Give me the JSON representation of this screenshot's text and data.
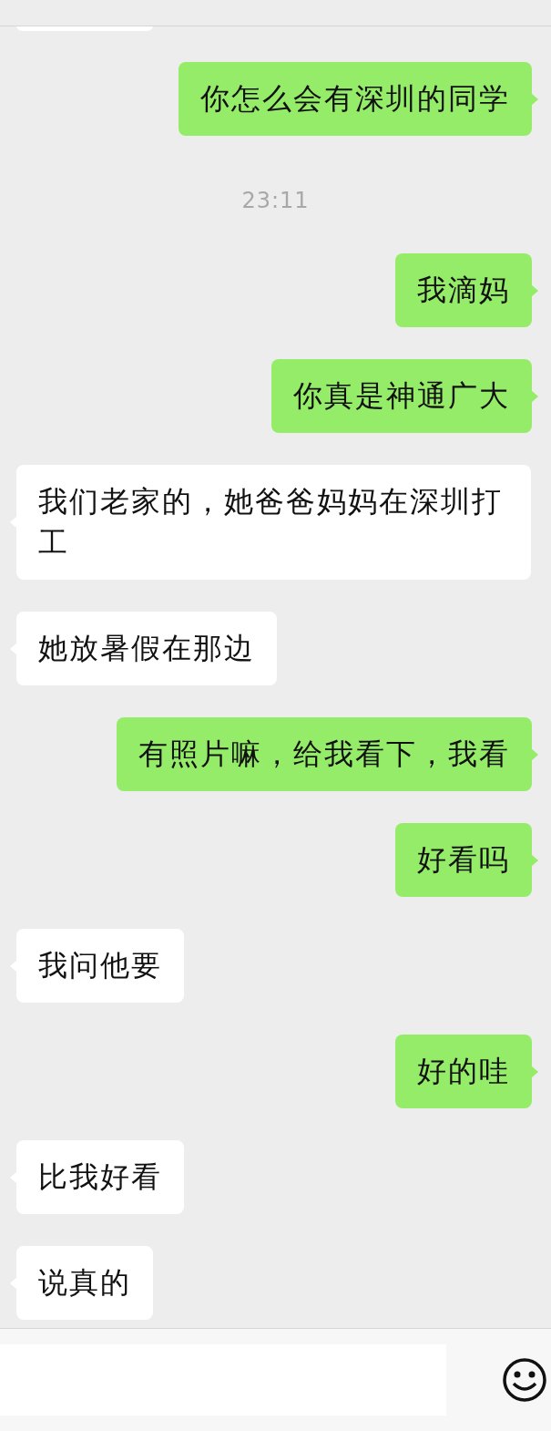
{
  "messages": [
    {
      "kind": "sent",
      "text": "你怎么会有深圳的同学"
    },
    {
      "kind": "time",
      "text": "23:11"
    },
    {
      "kind": "sent",
      "text": "我滴妈"
    },
    {
      "kind": "sent",
      "text": "你真是神通广大"
    },
    {
      "kind": "received",
      "text": "我们老家的，她爸爸妈妈在深圳打工"
    },
    {
      "kind": "received",
      "text": "她放暑假在那边"
    },
    {
      "kind": "sent",
      "text": "有照片嘛，给我看下，我看"
    },
    {
      "kind": "sent",
      "text": "好看吗"
    },
    {
      "kind": "received",
      "text": "我问他要"
    },
    {
      "kind": "sent",
      "text": "好的哇"
    },
    {
      "kind": "received",
      "text": "比我好看"
    },
    {
      "kind": "received",
      "text": "说真的"
    }
  ]
}
